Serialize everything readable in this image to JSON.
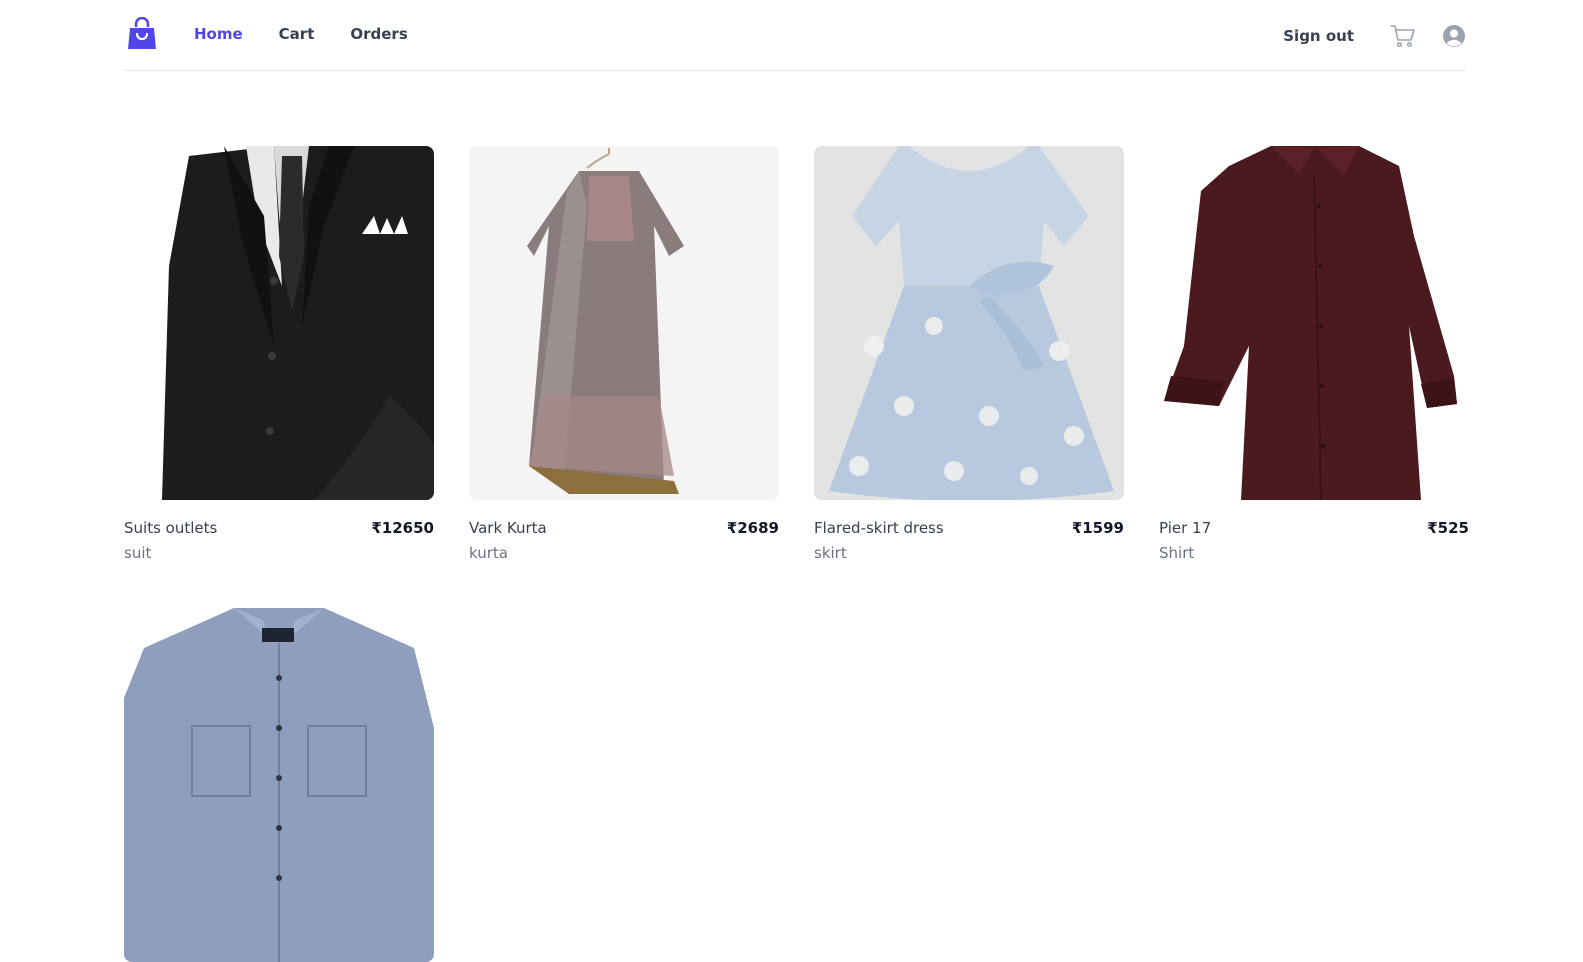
{
  "nav": {
    "items": [
      {
        "label": "Home"
      },
      {
        "label": "Cart"
      },
      {
        "label": "Orders"
      }
    ],
    "signout_label": "Sign out"
  },
  "icons": {
    "logo": "shopping-bag-icon",
    "cart": "cart-icon",
    "user": "user-circle-icon"
  },
  "colors": {
    "accent": "#4f46e5",
    "text": "#374151",
    "muted": "#6b7280",
    "border": "#e5e7eb"
  },
  "products": [
    {
      "title": "Suits outlets",
      "price": "₹12650",
      "category": "suit"
    },
    {
      "title": "Vark Kurta",
      "price": "₹2689",
      "category": "kurta"
    },
    {
      "title": "Flared-skirt dress",
      "price": "₹1599",
      "category": "skirt"
    },
    {
      "title": "Pier 17",
      "price": "₹525",
      "category": "Shirt"
    },
    {
      "title": "",
      "price": "",
      "category": ""
    }
  ]
}
